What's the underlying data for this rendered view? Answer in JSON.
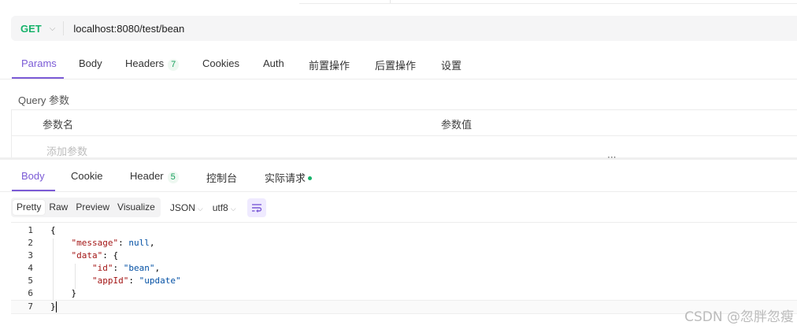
{
  "request": {
    "method": "GET",
    "url": "localhost:8080/test/bean"
  },
  "request_tabs": {
    "params": "Params",
    "body": "Body",
    "headers": "Headers",
    "headers_count": "7",
    "cookies": "Cookies",
    "auth": "Auth",
    "pre": "前置操作",
    "post": "后置操作",
    "settings": "设置"
  },
  "query": {
    "title": "Query 参数",
    "col_name": "参数名",
    "col_value": "参数值",
    "add_placeholder": "添加参数"
  },
  "divider_handle": "···",
  "response_tabs": {
    "body": "Body",
    "cookie": "Cookie",
    "header": "Header",
    "header_count": "5",
    "console": "控制台",
    "actual": "实际请求"
  },
  "view_modes": {
    "pretty": "Pretty",
    "raw": "Raw",
    "preview": "Preview",
    "visualize": "Visualize"
  },
  "format_select": "JSON",
  "encoding_select": "utf8",
  "code_lines": [
    {
      "n": "1",
      "parts": [
        [
          "p",
          "{"
        ]
      ]
    },
    {
      "n": "2",
      "parts": [
        [
          "p",
          "    "
        ],
        [
          "k",
          "\"message\""
        ],
        [
          "p",
          ": "
        ],
        [
          "s",
          "null"
        ],
        [
          "p",
          ","
        ]
      ]
    },
    {
      "n": "3",
      "parts": [
        [
          "p",
          "    "
        ],
        [
          "k",
          "\"data\""
        ],
        [
          "p",
          ": {"
        ]
      ]
    },
    {
      "n": "4",
      "parts": [
        [
          "p",
          "        "
        ],
        [
          "k",
          "\"id\""
        ],
        [
          "p",
          ": "
        ],
        [
          "s",
          "\"bean\""
        ],
        [
          "p",
          ","
        ]
      ]
    },
    {
      "n": "5",
      "parts": [
        [
          "p",
          "        "
        ],
        [
          "k",
          "\"appId\""
        ],
        [
          "p",
          ": "
        ],
        [
          "s",
          "\"update\""
        ]
      ]
    },
    {
      "n": "6",
      "parts": [
        [
          "p",
          "    }"
        ]
      ]
    },
    {
      "n": "7",
      "parts": [
        [
          "p",
          "}"
        ]
      ]
    }
  ],
  "watermark": "CSDN @忽胖忽瘦",
  "colors": {
    "accent": "#7b5bd6",
    "method_get": "#17b26a",
    "badge_text": "#17a05d",
    "json_key": "#a31515",
    "json_value": "#0451a5"
  }
}
